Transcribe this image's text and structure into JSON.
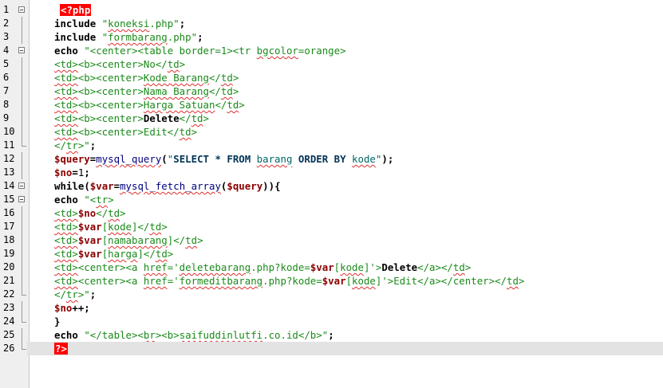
{
  "editor": {
    "language": "php",
    "current_line": 26,
    "colors": {
      "keyword": "#000000",
      "string": "#1a8a1a",
      "variable": "#8b0000",
      "function": "#000080",
      "php_tag_bg": "#ff0000",
      "current_line_bg": "#e3e3e3",
      "spellcheck_underline": "#e03030"
    },
    "lines": [
      {
        "n": "1",
        "fold": "open",
        "tokens": [
          {
            "c": "tag",
            "t": "<?php"
          }
        ]
      },
      {
        "n": "2",
        "fold": "line",
        "tokens": [
          {
            "c": "kw",
            "t": "include "
          },
          {
            "c": "str",
            "t": "\""
          },
          {
            "c": "str sq",
            "t": "koneksi"
          },
          {
            "c": "str",
            "t": ".php\""
          },
          {
            "c": "pun",
            "t": ";"
          }
        ]
      },
      {
        "n": "3",
        "fold": "line",
        "tokens": [
          {
            "c": "kw",
            "t": "include "
          },
          {
            "c": "str",
            "t": "\""
          },
          {
            "c": "str sq",
            "t": "formbarang"
          },
          {
            "c": "str",
            "t": ".php\""
          },
          {
            "c": "pun",
            "t": ";"
          }
        ]
      },
      {
        "n": "4",
        "fold": "open",
        "tokens": [
          {
            "c": "kw",
            "t": "echo "
          },
          {
            "c": "str",
            "t": "\"<center><table border=1><tr "
          },
          {
            "c": "str sq",
            "t": "bgcolor"
          },
          {
            "c": "str",
            "t": "=orange>"
          }
        ]
      },
      {
        "n": "5",
        "fold": "line",
        "tokens": [
          {
            "c": "str sq",
            "t": "<td>"
          },
          {
            "c": "str",
            "t": "<b><center>No</"
          },
          {
            "c": "str sq",
            "t": "td"
          },
          {
            "c": "str",
            "t": ">"
          }
        ]
      },
      {
        "n": "6",
        "fold": "line",
        "tokens": [
          {
            "c": "str sq",
            "t": "<td>"
          },
          {
            "c": "str",
            "t": "<b><center>"
          },
          {
            "c": "str sq",
            "t": "Kode Barang"
          },
          {
            "c": "str",
            "t": "</"
          },
          {
            "c": "str sq",
            "t": "td"
          },
          {
            "c": "str",
            "t": ">"
          }
        ]
      },
      {
        "n": "7",
        "fold": "line",
        "tokens": [
          {
            "c": "str sq",
            "t": "<td>"
          },
          {
            "c": "str",
            "t": "<b><center>"
          },
          {
            "c": "str sq",
            "t": "Nama Barang"
          },
          {
            "c": "str",
            "t": "</"
          },
          {
            "c": "str sq",
            "t": "td"
          },
          {
            "c": "str",
            "t": ">"
          }
        ]
      },
      {
        "n": "8",
        "fold": "line",
        "tokens": [
          {
            "c": "str sq",
            "t": "<td>"
          },
          {
            "c": "str",
            "t": "<b><center>"
          },
          {
            "c": "str sq",
            "t": "Harga Satuan"
          },
          {
            "c": "str",
            "t": "</"
          },
          {
            "c": "str sq",
            "t": "td"
          },
          {
            "c": "str",
            "t": ">"
          }
        ]
      },
      {
        "n": "9",
        "fold": "line",
        "tokens": [
          {
            "c": "str sq",
            "t": "<td>"
          },
          {
            "c": "str",
            "t": "<b><center>"
          },
          {
            "c": "kw",
            "t": "Delete"
          },
          {
            "c": "str",
            "t": "</"
          },
          {
            "c": "str sq",
            "t": "td"
          },
          {
            "c": "str",
            "t": ">"
          }
        ]
      },
      {
        "n": "10",
        "fold": "line",
        "tokens": [
          {
            "c": "str sq",
            "t": "<td>"
          },
          {
            "c": "str",
            "t": "<b><center>Edit</"
          },
          {
            "c": "str sq",
            "t": "td"
          },
          {
            "c": "str",
            "t": ">"
          }
        ]
      },
      {
        "n": "11",
        "fold": "end",
        "tokens": [
          {
            "c": "str",
            "t": "</"
          },
          {
            "c": "str sq",
            "t": "tr"
          },
          {
            "c": "str",
            "t": ">\""
          },
          {
            "c": "pun",
            "t": ";"
          }
        ]
      },
      {
        "n": "12",
        "fold": "line",
        "tokens": [
          {
            "c": "var",
            "t": "$query"
          },
          {
            "c": "pun",
            "t": "="
          },
          {
            "c": "fn sq",
            "t": "mysql_query"
          },
          {
            "c": "pun",
            "t": "("
          },
          {
            "c": "sqs",
            "t": "\""
          },
          {
            "c": "sql",
            "t": "SELECT * FROM "
          },
          {
            "c": "sqs sq",
            "t": "barang"
          },
          {
            "c": "sql",
            "t": " ORDER BY "
          },
          {
            "c": "sqs sq",
            "t": "kode"
          },
          {
            "c": "sqs",
            "t": "\""
          },
          {
            "c": "pun",
            "t": ");"
          }
        ]
      },
      {
        "n": "13",
        "fold": "line",
        "tokens": [
          {
            "c": "var",
            "t": "$no"
          },
          {
            "c": "pun",
            "t": "="
          },
          {
            "c": "num",
            "t": "1"
          },
          {
            "c": "pun",
            "t": ";"
          }
        ]
      },
      {
        "n": "14",
        "fold": "open",
        "tokens": [
          {
            "c": "kw",
            "t": "while"
          },
          {
            "c": "pun",
            "t": "("
          },
          {
            "c": "var",
            "t": "$var"
          },
          {
            "c": "pun",
            "t": "="
          },
          {
            "c": "fn sq",
            "t": "mysql_fetch_array"
          },
          {
            "c": "pun",
            "t": "("
          },
          {
            "c": "var",
            "t": "$query"
          },
          {
            "c": "pun",
            "t": ")){"
          }
        ]
      },
      {
        "n": "15",
        "fold": "open",
        "tokens": [
          {
            "c": "kw",
            "t": "echo "
          },
          {
            "c": "str",
            "t": "\"<"
          },
          {
            "c": "str sq",
            "t": "tr"
          },
          {
            "c": "str",
            "t": ">"
          }
        ]
      },
      {
        "n": "16",
        "fold": "line",
        "tokens": [
          {
            "c": "str sq",
            "t": "<td>"
          },
          {
            "c": "var",
            "t": "$no"
          },
          {
            "c": "str",
            "t": "</"
          },
          {
            "c": "str sq",
            "t": "td"
          },
          {
            "c": "str",
            "t": ">"
          }
        ]
      },
      {
        "n": "17",
        "fold": "line",
        "tokens": [
          {
            "c": "str sq",
            "t": "<td>"
          },
          {
            "c": "var",
            "t": "$var"
          },
          {
            "c": "str",
            "t": "["
          },
          {
            "c": "str sq",
            "t": "kode"
          },
          {
            "c": "str",
            "t": "]</"
          },
          {
            "c": "str sq",
            "t": "td"
          },
          {
            "c": "str",
            "t": ">"
          }
        ]
      },
      {
        "n": "18",
        "fold": "line",
        "tokens": [
          {
            "c": "str sq",
            "t": "<td>"
          },
          {
            "c": "var",
            "t": "$var"
          },
          {
            "c": "str",
            "t": "["
          },
          {
            "c": "str sq",
            "t": "namabarang"
          },
          {
            "c": "str",
            "t": "]</"
          },
          {
            "c": "str sq",
            "t": "td"
          },
          {
            "c": "str",
            "t": ">"
          }
        ]
      },
      {
        "n": "19",
        "fold": "line",
        "tokens": [
          {
            "c": "str sq",
            "t": "<td>"
          },
          {
            "c": "var",
            "t": "$var"
          },
          {
            "c": "str",
            "t": "["
          },
          {
            "c": "str sq",
            "t": "harga"
          },
          {
            "c": "str",
            "t": "]</"
          },
          {
            "c": "str sq",
            "t": "td"
          },
          {
            "c": "str",
            "t": ">"
          }
        ]
      },
      {
        "n": "20",
        "fold": "line",
        "tokens": [
          {
            "c": "str sq",
            "t": "<td>"
          },
          {
            "c": "str",
            "t": "<center><a "
          },
          {
            "c": "str sq",
            "t": "href"
          },
          {
            "c": "str",
            "t": "='"
          },
          {
            "c": "str sq",
            "t": "deletebarang"
          },
          {
            "c": "str",
            "t": ".php?kode="
          },
          {
            "c": "var",
            "t": "$var"
          },
          {
            "c": "str",
            "t": "["
          },
          {
            "c": "str sq",
            "t": "kode"
          },
          {
            "c": "str",
            "t": "]'>"
          },
          {
            "c": "kw",
            "t": "Delete"
          },
          {
            "c": "str",
            "t": "</a></"
          },
          {
            "c": "str sq",
            "t": "td"
          },
          {
            "c": "str",
            "t": ">"
          }
        ]
      },
      {
        "n": "21",
        "fold": "line",
        "tokens": [
          {
            "c": "str sq",
            "t": "<td>"
          },
          {
            "c": "str",
            "t": "<center><a "
          },
          {
            "c": "str sq",
            "t": "href"
          },
          {
            "c": "str",
            "t": "='"
          },
          {
            "c": "str sq",
            "t": "formeditbarang"
          },
          {
            "c": "str",
            "t": ".php?kode="
          },
          {
            "c": "var",
            "t": "$var"
          },
          {
            "c": "str",
            "t": "["
          },
          {
            "c": "str sq",
            "t": "kode"
          },
          {
            "c": "str",
            "t": "]'>Edit</a></center></"
          },
          {
            "c": "str sq",
            "t": "td"
          },
          {
            "c": "str",
            "t": ">"
          }
        ]
      },
      {
        "n": "22",
        "fold": "end",
        "tokens": [
          {
            "c": "str",
            "t": "</"
          },
          {
            "c": "str sq",
            "t": "tr"
          },
          {
            "c": "str",
            "t": ">\""
          },
          {
            "c": "pun",
            "t": ";"
          }
        ]
      },
      {
        "n": "23",
        "fold": "line",
        "tokens": [
          {
            "c": "var",
            "t": "$no"
          },
          {
            "c": "pun",
            "t": "++;"
          }
        ]
      },
      {
        "n": "24",
        "fold": "end",
        "tokens": [
          {
            "c": "pun",
            "t": "}"
          }
        ]
      },
      {
        "n": "25",
        "fold": "line",
        "tokens": [
          {
            "c": "kw",
            "t": "echo "
          },
          {
            "c": "str",
            "t": "\"</table><"
          },
          {
            "c": "str sq",
            "t": "br"
          },
          {
            "c": "str",
            "t": "><b>"
          },
          {
            "c": "str sq",
            "t": "saifuddinlutfi"
          },
          {
            "c": "str",
            "t": ".co.id</b>\""
          },
          {
            "c": "pun",
            "t": ";"
          }
        ]
      },
      {
        "n": "26",
        "fold": "end",
        "tokens": [
          {
            "c": "tag",
            "t": "?>"
          }
        ]
      }
    ]
  }
}
